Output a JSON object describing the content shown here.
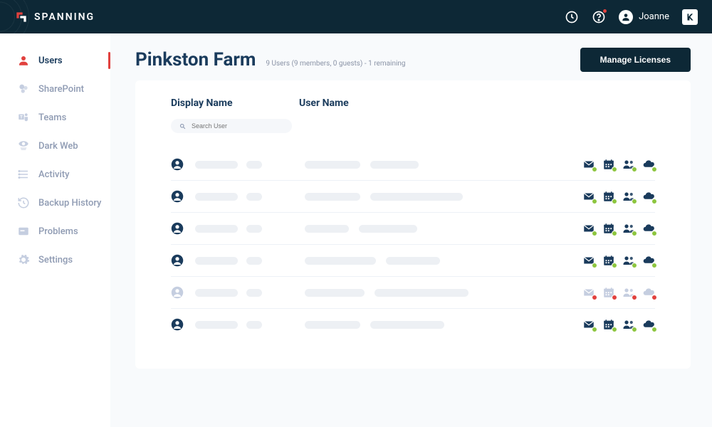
{
  "header": {
    "brand": "SPANNING",
    "user_name": "Joanne",
    "kaseya_badge": "K"
  },
  "sidebar": {
    "items": [
      {
        "label": "Users",
        "icon": "user",
        "active": true
      },
      {
        "label": "SharePoint",
        "icon": "sharepoint",
        "active": false
      },
      {
        "label": "Teams",
        "icon": "teams",
        "active": false
      },
      {
        "label": "Dark Web",
        "icon": "darkweb",
        "active": false
      },
      {
        "label": "Activity",
        "icon": "activity",
        "active": false
      },
      {
        "label": "Backup History",
        "icon": "history",
        "active": false
      },
      {
        "label": "Problems",
        "icon": "problems",
        "active": false
      },
      {
        "label": "Settings",
        "icon": "settings",
        "active": false
      }
    ]
  },
  "page": {
    "title": "Pinkston Farm",
    "subtitle": "9 Users (9 members, 0 guests) - 1 remaining",
    "manage_button": "Manage Licenses"
  },
  "table": {
    "col_display": "Display Name",
    "col_username": "User Name",
    "search_placeholder": "Search User"
  },
  "rows": [
    {
      "guest": false,
      "uw": 78,
      "ew": 68,
      "status": "ok"
    },
    {
      "guest": false,
      "uw": 78,
      "ew": 130,
      "status": "ok"
    },
    {
      "guest": false,
      "uw": 62,
      "ew": 82,
      "status": "ok"
    },
    {
      "guest": false,
      "uw": 100,
      "ew": 76,
      "status": "ok"
    },
    {
      "guest": true,
      "uw": 84,
      "ew": 132,
      "status": "err"
    },
    {
      "guest": false,
      "uw": 78,
      "ew": 104,
      "status": "ok"
    }
  ]
}
